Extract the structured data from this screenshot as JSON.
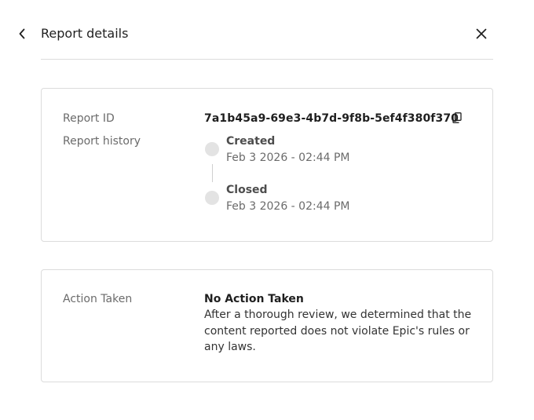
{
  "header": {
    "title": "Report details",
    "back_icon": "chevron-left-icon",
    "close_icon": "close-icon"
  },
  "report_card": {
    "report_id_label": "Report ID",
    "report_id_value": "7a1b45a9-69e3-4b7d-9f8b-5ef4f380f370",
    "copy_icon": "copy-icon",
    "history_label": "Report history",
    "history": [
      {
        "status": "Created",
        "date": "Feb 3 2026 - 02:44 PM"
      },
      {
        "status": "Closed",
        "date": "Feb 3 2026 - 02:44 PM"
      }
    ]
  },
  "action_card": {
    "label": "Action Taken",
    "title": "No Action Taken",
    "description": "After a thorough review, we determined that the content reported does not violate Epic's rules or any laws."
  },
  "colors": {
    "text_primary": "#1f1f1f",
    "text_secondary": "#6b6b6b",
    "border": "#dcdcdc",
    "timeline_dot": "#e3e3e3"
  }
}
